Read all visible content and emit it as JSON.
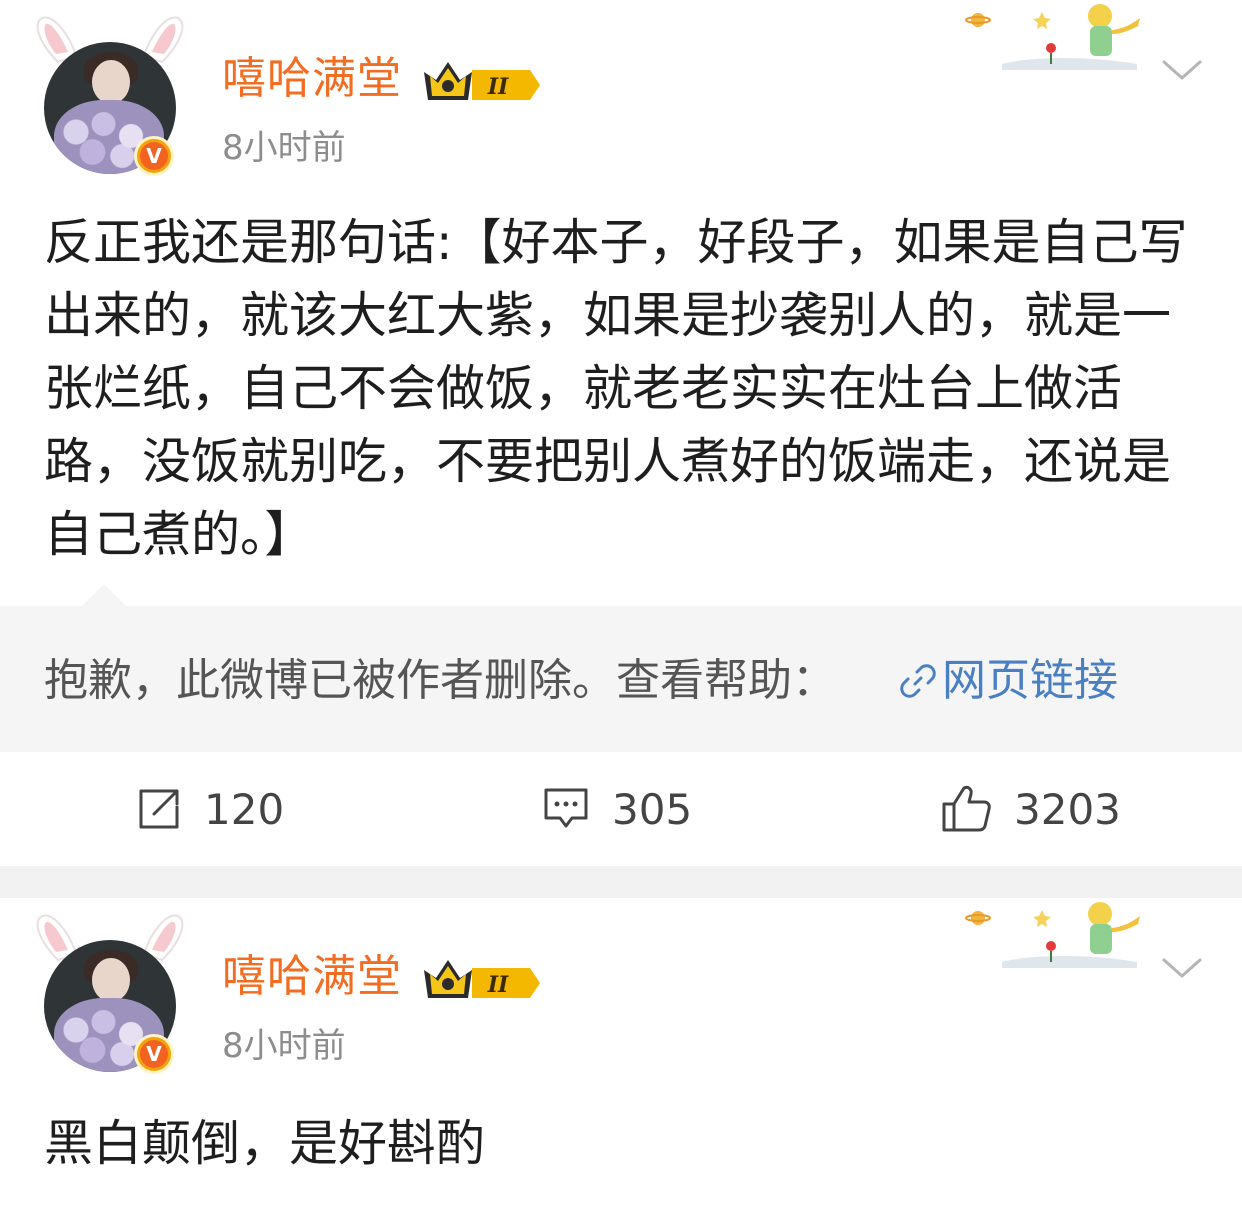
{
  "posts": [
    {
      "username": "嘻哈满堂",
      "badge_level": "II",
      "verified_mark": "V",
      "timestamp": "8小时前",
      "text": "反正我还是那句话:【好本子，好段子，如果是自己写出来的，就该大红大紫，如果是抄袭别人的，就是一张烂纸，自己不会做饭，就老老实实在灶台上做活路，没饭就别吃，不要把别人煮好的饭端走，还说是自己煮的。】",
      "deleted_notice": "抱歉，此微博已被作者删除。查看帮助：",
      "help_link_label": "网页链接",
      "repost_count": "120",
      "comment_count": "305",
      "like_count": "3203"
    },
    {
      "username": "嘻哈满堂",
      "badge_level": "II",
      "verified_mark": "V",
      "timestamp": "8小时前",
      "text": "黑白颠倒，是好斟酌"
    }
  ],
  "icons": {
    "repost": "repost-icon",
    "comment": "comment-icon",
    "like": "thumbs-up-icon",
    "link": "link-icon",
    "more": "chevron-down-icon"
  },
  "colors": {
    "username": "#f26c22",
    "link": "#4a7fc1",
    "timestamp": "#8d8d8d",
    "deleted_bg": "#f5f5f5",
    "separator": "#f2f2f2"
  }
}
